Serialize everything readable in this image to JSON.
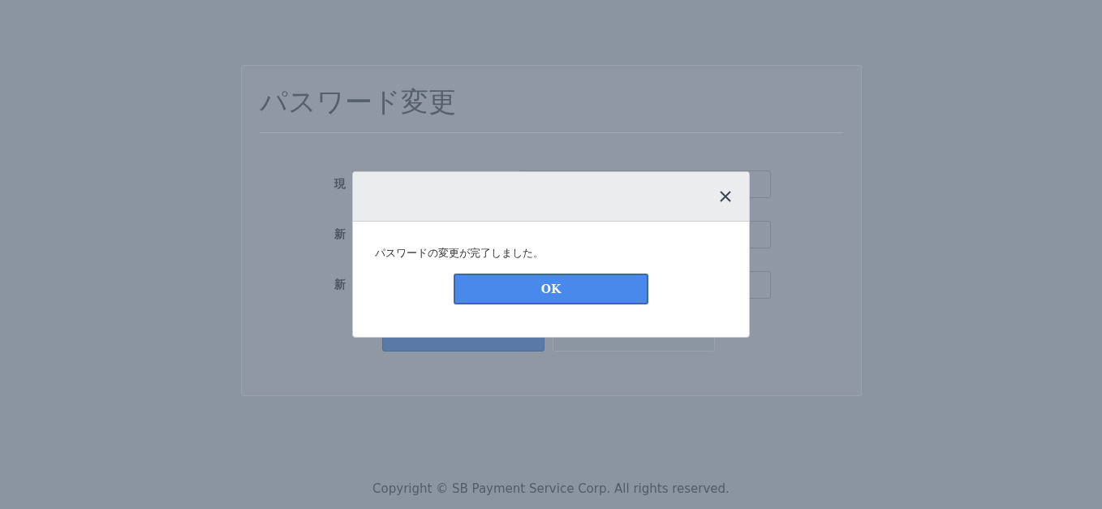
{
  "page": {
    "title": "パスワード変更",
    "fields": [
      {
        "label": "現"
      },
      {
        "label": "新"
      },
      {
        "label": "新"
      }
    ]
  },
  "dialog": {
    "message": "パスワードの変更が完了しました。",
    "button": "OK"
  },
  "footer": "Copyright © SB Payment Service Corp. All rights reserved."
}
